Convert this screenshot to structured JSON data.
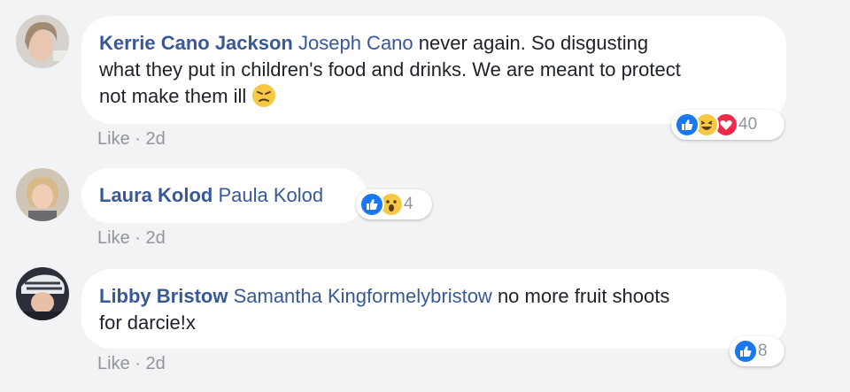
{
  "comments": [
    {
      "author": "Kerrie Cano Jackson",
      "mention": "Joseph Cano",
      "text_line1": " never again. So disgusting",
      "text_line2": "what they put in children's food and drinks. We are meant to protect",
      "text_line3": "not make them ill",
      "inline_emoji": "angry-face",
      "like_label": "Like",
      "separator": " · ",
      "time": "2d",
      "reactions": [
        "like",
        "haha",
        "love"
      ],
      "reaction_count": "40"
    },
    {
      "author": "Laura Kolod",
      "mention": "Paula Kolod",
      "like_label": "Like",
      "separator": " · ",
      "time": "2d",
      "reactions": [
        "like",
        "wow"
      ],
      "reaction_count": "4"
    },
    {
      "author": "Libby Bristow",
      "mention": "Samantha Kingformelybristow",
      "text_line1": " no more fruit shoots",
      "text_line2": "for darcie!x",
      "like_label": "Like",
      "separator": " · ",
      "time": "2d",
      "reactions": [
        "like"
      ],
      "reaction_count": "8"
    }
  ],
  "colors": {
    "background": "#f2f3f5",
    "name_link": "#385898",
    "meta": "#90949c",
    "like_blue": "#1877f2",
    "love_red": "#f0284a",
    "haha_yellow": "#f7c844"
  }
}
